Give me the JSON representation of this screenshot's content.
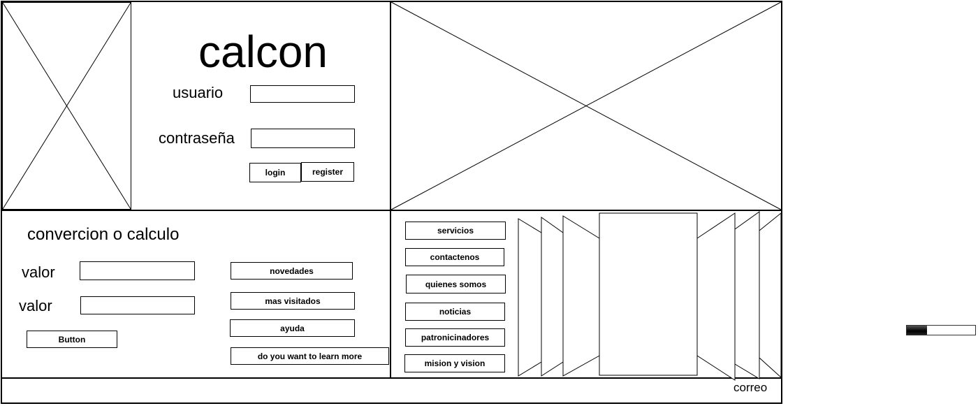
{
  "header": {
    "title": "calcon",
    "username_label": "usuario",
    "password_label": "contraseña",
    "username_value": "",
    "password_value": "",
    "login_label": "login",
    "register_label": "register"
  },
  "converter": {
    "title": "convercion o calculo",
    "value1_label": "valor",
    "value2_label": "valor",
    "value1": "",
    "value2": "",
    "button_label": "Button"
  },
  "links": [
    {
      "label": "novedades"
    },
    {
      "label": "mas visitados"
    },
    {
      "label": "ayuda"
    },
    {
      "label": "do you want to learn more"
    }
  ],
  "menu": [
    {
      "label": "servicios"
    },
    {
      "label": "contactenos"
    },
    {
      "label": "quienes somos"
    },
    {
      "label": "noticias"
    },
    {
      "label": "patronicinadores"
    },
    {
      "label": "mision y vision"
    }
  ],
  "footer": {
    "email_label": "correo"
  },
  "progress": {
    "value_percent": 30,
    "fill_color": "#000000"
  }
}
